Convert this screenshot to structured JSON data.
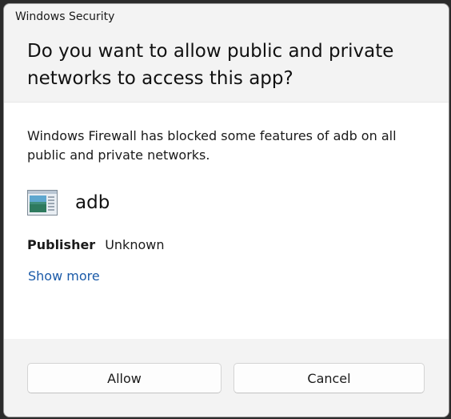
{
  "window": {
    "title": "Windows Security"
  },
  "header": {
    "heading": "Do you want to allow public and private networks to access this app?"
  },
  "body": {
    "message": "Windows Firewall has blocked some features of adb on all public and private networks.",
    "app": {
      "icon": "app-window-icon",
      "name": "adb"
    },
    "publisher": {
      "label": "Publisher",
      "value": "Unknown"
    },
    "show_more": "Show more"
  },
  "footer": {
    "allow_label": "Allow",
    "cancel_label": "Cancel"
  },
  "colors": {
    "link": "#1a5aa8",
    "dialog_bg": "#f3f3f3",
    "content_bg": "#ffffff"
  }
}
